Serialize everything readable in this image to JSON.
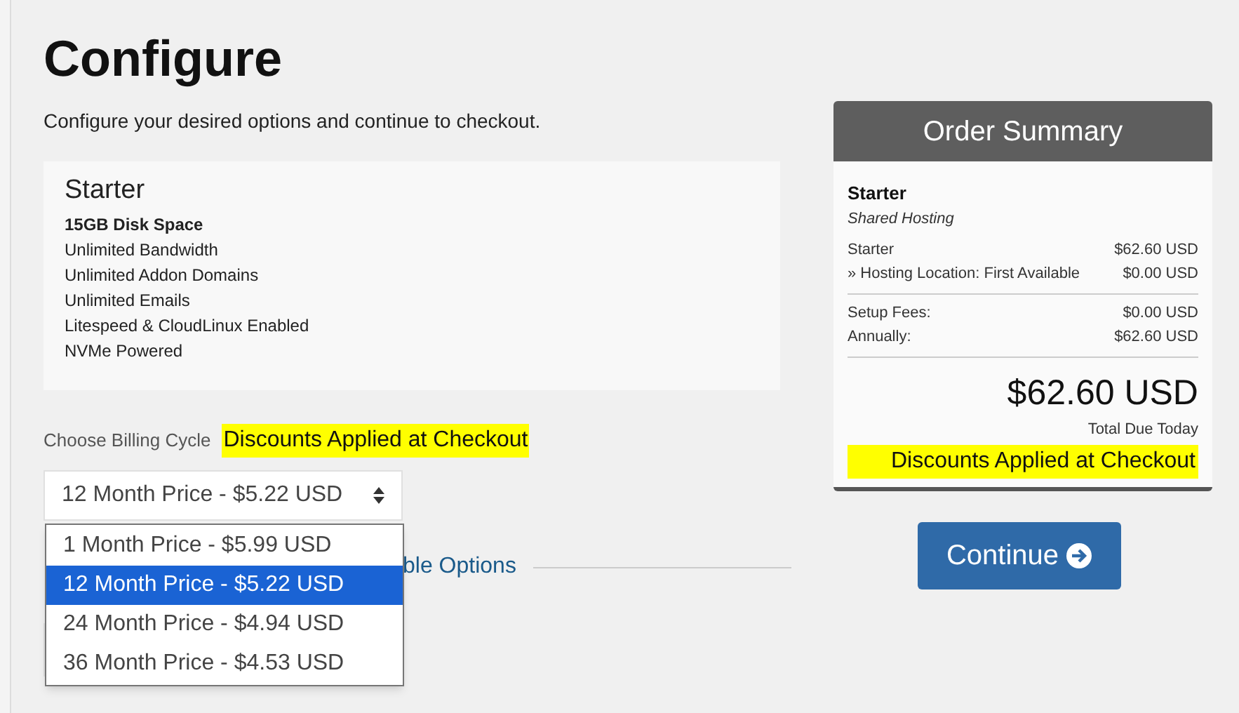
{
  "page": {
    "title": "Configure",
    "description": "Configure your desired options and continue to checkout."
  },
  "product": {
    "name": "Starter",
    "features": [
      {
        "text": "15GB Disk Space",
        "bold": true
      },
      {
        "text": "Unlimited Bandwidth",
        "bold": false
      },
      {
        "text": "Unlimited Addon Domains",
        "bold": false
      },
      {
        "text": "Unlimited Emails",
        "bold": false
      },
      {
        "text": "Litespeed & CloudLinux Enabled",
        "bold": false
      },
      {
        "text": "NVMe Powered",
        "bold": false
      }
    ]
  },
  "billing": {
    "label": "Choose Billing Cycle",
    "highlight": "Discounts Applied at Checkout",
    "value": "12 Month Price - $5.22 USD",
    "expanded": true,
    "options": [
      {
        "label": "1 Month Price - $5.99 USD",
        "selected": false
      },
      {
        "label": "12 Month Price - $5.22 USD",
        "selected": true
      },
      {
        "label": "24 Month Price - $4.94 USD",
        "selected": false
      },
      {
        "label": "36 Month Price - $4.53 USD",
        "selected": false
      }
    ]
  },
  "section_link": "ble Options",
  "continue_button": "Continue",
  "order_summary": {
    "title": "Order Summary",
    "product": "Starter",
    "group": "Shared Hosting",
    "lines": [
      {
        "label": "Starter",
        "amount": "$62.60 USD"
      },
      {
        "label": "» Hosting Location: First Available",
        "amount": "$0.00 USD"
      }
    ],
    "fees": [
      {
        "label": "Setup Fees:",
        "amount": "$0.00 USD"
      },
      {
        "label": "Annually:",
        "amount": "$62.60 USD"
      }
    ],
    "total": "$62.60 USD",
    "total_label": "Total Due Today",
    "highlight": "Discounts Applied at Checkout"
  }
}
